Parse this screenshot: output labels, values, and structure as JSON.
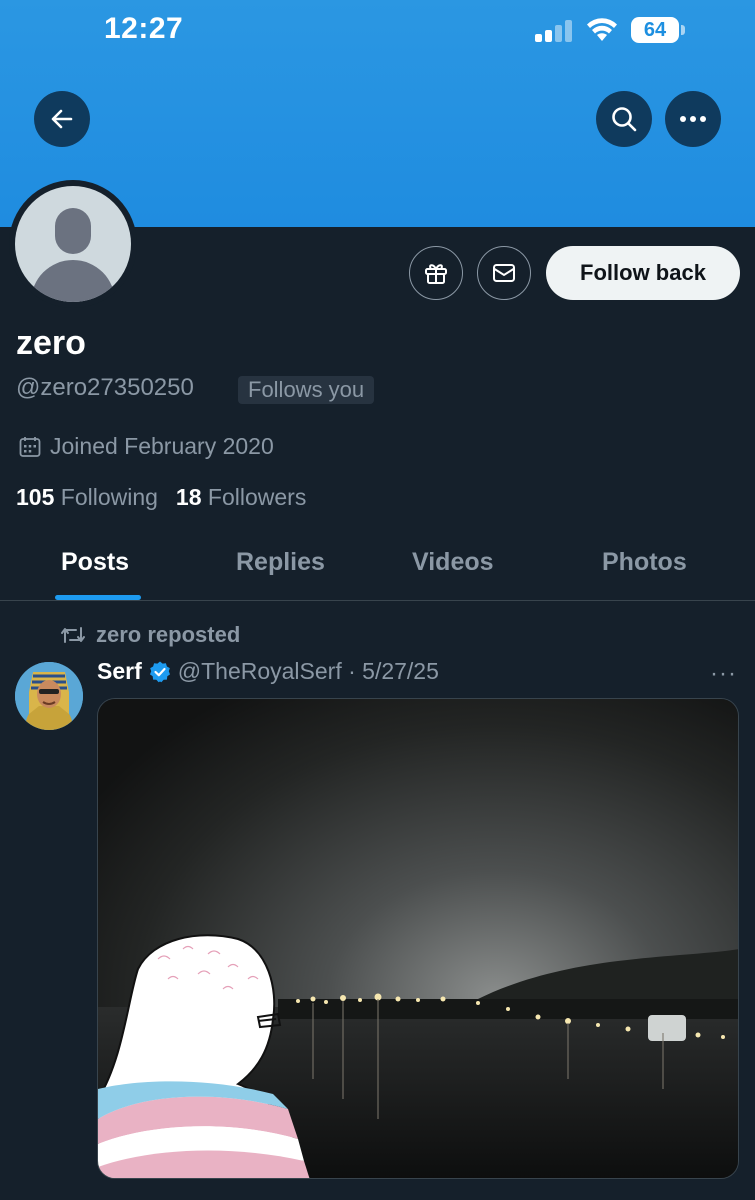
{
  "status_bar": {
    "time": "12:27",
    "battery": "64"
  },
  "header": {
    "back_icon": "arrow-left-icon",
    "search_icon": "search-icon",
    "more_icon": "more-horizontal-icon"
  },
  "profile": {
    "display_name": "zero",
    "handle": "@zero27350250",
    "follows_you": "Follows you",
    "joined": "Joined February 2020",
    "following_count": "105",
    "following_label": "Following",
    "followers_count": "18",
    "followers_label": "Followers",
    "follow_button": "Follow back"
  },
  "tabs": [
    {
      "label": "Posts",
      "active": true
    },
    {
      "label": "Replies",
      "active": false
    },
    {
      "label": "Videos",
      "active": false
    },
    {
      "label": "Photos",
      "active": false
    }
  ],
  "post": {
    "repost_label": "zero reposted",
    "author": "Serf",
    "handle_date": "@TheRoyalSerf · 5/27/25",
    "more": "···"
  },
  "colors": {
    "accent": "#1d9bf0",
    "background": "#15202b",
    "banner": "#1f8ce0"
  }
}
